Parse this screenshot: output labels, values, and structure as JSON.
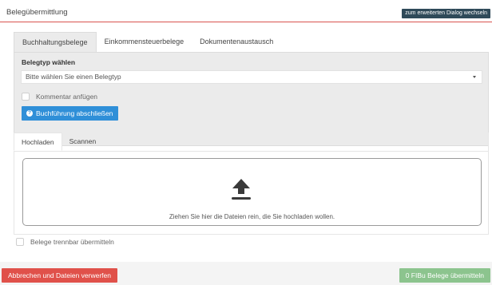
{
  "header": {
    "title": "Belegübermittlung",
    "extended_dialog_button": "zum erweiterten Dialog wechseln"
  },
  "main_tabs": [
    {
      "label": "Buchhaltungsbelege",
      "active": true
    },
    {
      "label": "Einkommensteuerbelege",
      "active": false
    },
    {
      "label": "Dokumentenaustausch",
      "active": false
    }
  ],
  "belegtyp": {
    "label": "Belegtyp wählen",
    "placeholder": "Bitte wählen Sie einen Belegtyp"
  },
  "comment_checkbox": {
    "label": "Kommentar anfügen",
    "checked": false
  },
  "finish_button": {
    "label": "Buchführung abschließen",
    "icon": "question-circle-icon"
  },
  "upload_tabs": [
    {
      "label": "Hochladen",
      "active": true
    },
    {
      "label": "Scannen",
      "active": false
    }
  ],
  "dropzone": {
    "icon": "upload-icon",
    "text": "Ziehen Sie hier die Dateien rein, die Sie hochladen wollen."
  },
  "separable_checkbox": {
    "label": "Belege trennbar übermitteln",
    "checked": false
  },
  "footer": {
    "cancel_label": "Abbrechen und Dateien verwerfen",
    "submit_label": "0 FIBu Belege übermitteln"
  },
  "colors": {
    "accent_red": "#e0514a",
    "primary_blue": "#2f8fd8",
    "success_green": "#8cc48e",
    "header_dark": "#2f4a59"
  }
}
